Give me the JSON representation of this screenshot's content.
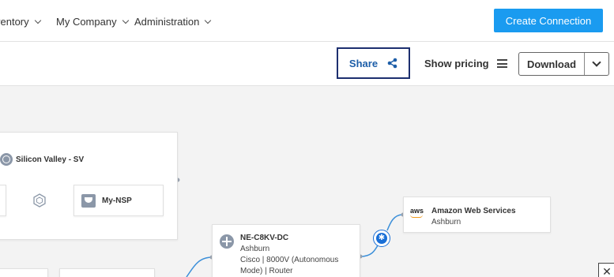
{
  "nav": {
    "items": [
      {
        "label": "ventory"
      },
      {
        "label": "My Company"
      },
      {
        "label": "Administration"
      }
    ],
    "create_button": "Create Connection"
  },
  "toolbar": {
    "share_label": "Share",
    "pricing_label": "Show pricing",
    "download_label": "Download"
  },
  "diagram": {
    "region": {
      "title": "Silicon Valley - SV"
    },
    "nsp": {
      "label": "My-NSP"
    },
    "aws": {
      "name": "Amazon Web Services",
      "location": "Ashburn",
      "logo_text": "aws"
    },
    "device": {
      "name": "NE-C8KV-DC",
      "location": "Ashburn",
      "line1": "Cisco | 8000V (Autonomous",
      "line2": "Mode) | Router"
    }
  },
  "colors": {
    "accent": "#1a9bf0",
    "share_border": "#1d2f6f",
    "node_icon": "#8b97a8",
    "connector": "#1a6fd6"
  },
  "icons": [
    "chevron-down-icon",
    "share-icon",
    "menu-icon",
    "globe-icon",
    "hexagon-icon",
    "nsp-icon",
    "router-icon",
    "connector-icon",
    "close-icon"
  ]
}
